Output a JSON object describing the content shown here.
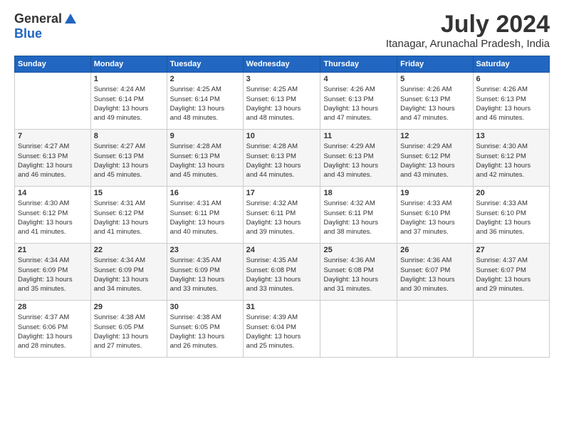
{
  "header": {
    "logo_general": "General",
    "logo_blue": "Blue",
    "month_year": "July 2024",
    "location": "Itanagar, Arunachal Pradesh, India"
  },
  "weekdays": [
    "Sunday",
    "Monday",
    "Tuesday",
    "Wednesday",
    "Thursday",
    "Friday",
    "Saturday"
  ],
  "weeks": [
    [
      {
        "day": "",
        "info": ""
      },
      {
        "day": "1",
        "info": "Sunrise: 4:24 AM\nSunset: 6:14 PM\nDaylight: 13 hours\nand 49 minutes."
      },
      {
        "day": "2",
        "info": "Sunrise: 4:25 AM\nSunset: 6:14 PM\nDaylight: 13 hours\nand 48 minutes."
      },
      {
        "day": "3",
        "info": "Sunrise: 4:25 AM\nSunset: 6:13 PM\nDaylight: 13 hours\nand 48 minutes."
      },
      {
        "day": "4",
        "info": "Sunrise: 4:26 AM\nSunset: 6:13 PM\nDaylight: 13 hours\nand 47 minutes."
      },
      {
        "day": "5",
        "info": "Sunrise: 4:26 AM\nSunset: 6:13 PM\nDaylight: 13 hours\nand 47 minutes."
      },
      {
        "day": "6",
        "info": "Sunrise: 4:26 AM\nSunset: 6:13 PM\nDaylight: 13 hours\nand 46 minutes."
      }
    ],
    [
      {
        "day": "7",
        "info": "Sunrise: 4:27 AM\nSunset: 6:13 PM\nDaylight: 13 hours\nand 46 minutes."
      },
      {
        "day": "8",
        "info": "Sunrise: 4:27 AM\nSunset: 6:13 PM\nDaylight: 13 hours\nand 45 minutes."
      },
      {
        "day": "9",
        "info": "Sunrise: 4:28 AM\nSunset: 6:13 PM\nDaylight: 13 hours\nand 45 minutes."
      },
      {
        "day": "10",
        "info": "Sunrise: 4:28 AM\nSunset: 6:13 PM\nDaylight: 13 hours\nand 44 minutes."
      },
      {
        "day": "11",
        "info": "Sunrise: 4:29 AM\nSunset: 6:13 PM\nDaylight: 13 hours\nand 43 minutes."
      },
      {
        "day": "12",
        "info": "Sunrise: 4:29 AM\nSunset: 6:12 PM\nDaylight: 13 hours\nand 43 minutes."
      },
      {
        "day": "13",
        "info": "Sunrise: 4:30 AM\nSunset: 6:12 PM\nDaylight: 13 hours\nand 42 minutes."
      }
    ],
    [
      {
        "day": "14",
        "info": "Sunrise: 4:30 AM\nSunset: 6:12 PM\nDaylight: 13 hours\nand 41 minutes."
      },
      {
        "day": "15",
        "info": "Sunrise: 4:31 AM\nSunset: 6:12 PM\nDaylight: 13 hours\nand 41 minutes."
      },
      {
        "day": "16",
        "info": "Sunrise: 4:31 AM\nSunset: 6:11 PM\nDaylight: 13 hours\nand 40 minutes."
      },
      {
        "day": "17",
        "info": "Sunrise: 4:32 AM\nSunset: 6:11 PM\nDaylight: 13 hours\nand 39 minutes."
      },
      {
        "day": "18",
        "info": "Sunrise: 4:32 AM\nSunset: 6:11 PM\nDaylight: 13 hours\nand 38 minutes."
      },
      {
        "day": "19",
        "info": "Sunrise: 4:33 AM\nSunset: 6:10 PM\nDaylight: 13 hours\nand 37 minutes."
      },
      {
        "day": "20",
        "info": "Sunrise: 4:33 AM\nSunset: 6:10 PM\nDaylight: 13 hours\nand 36 minutes."
      }
    ],
    [
      {
        "day": "21",
        "info": "Sunrise: 4:34 AM\nSunset: 6:09 PM\nDaylight: 13 hours\nand 35 minutes."
      },
      {
        "day": "22",
        "info": "Sunrise: 4:34 AM\nSunset: 6:09 PM\nDaylight: 13 hours\nand 34 minutes."
      },
      {
        "day": "23",
        "info": "Sunrise: 4:35 AM\nSunset: 6:09 PM\nDaylight: 13 hours\nand 33 minutes."
      },
      {
        "day": "24",
        "info": "Sunrise: 4:35 AM\nSunset: 6:08 PM\nDaylight: 13 hours\nand 33 minutes."
      },
      {
        "day": "25",
        "info": "Sunrise: 4:36 AM\nSunset: 6:08 PM\nDaylight: 13 hours\nand 31 minutes."
      },
      {
        "day": "26",
        "info": "Sunrise: 4:36 AM\nSunset: 6:07 PM\nDaylight: 13 hours\nand 30 minutes."
      },
      {
        "day": "27",
        "info": "Sunrise: 4:37 AM\nSunset: 6:07 PM\nDaylight: 13 hours\nand 29 minutes."
      }
    ],
    [
      {
        "day": "28",
        "info": "Sunrise: 4:37 AM\nSunset: 6:06 PM\nDaylight: 13 hours\nand 28 minutes."
      },
      {
        "day": "29",
        "info": "Sunrise: 4:38 AM\nSunset: 6:05 PM\nDaylight: 13 hours\nand 27 minutes."
      },
      {
        "day": "30",
        "info": "Sunrise: 4:38 AM\nSunset: 6:05 PM\nDaylight: 13 hours\nand 26 minutes."
      },
      {
        "day": "31",
        "info": "Sunrise: 4:39 AM\nSunset: 6:04 PM\nDaylight: 13 hours\nand 25 minutes."
      },
      {
        "day": "",
        "info": ""
      },
      {
        "day": "",
        "info": ""
      },
      {
        "day": "",
        "info": ""
      }
    ]
  ]
}
